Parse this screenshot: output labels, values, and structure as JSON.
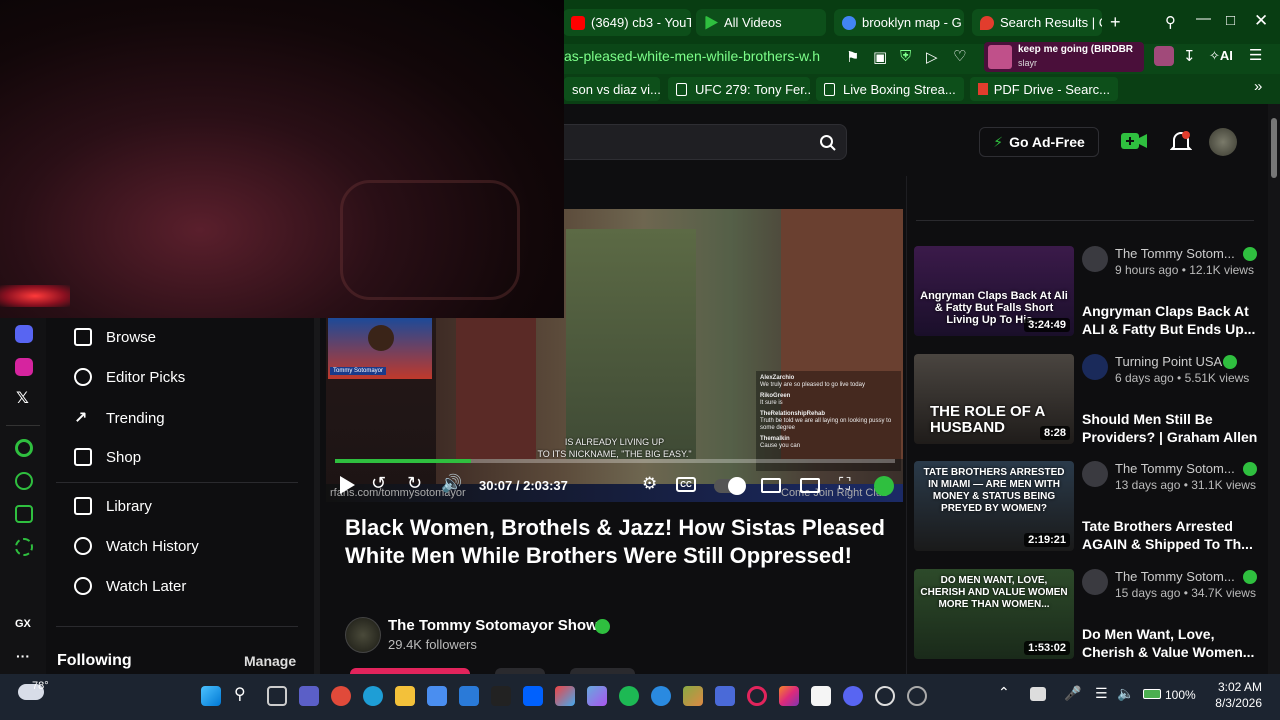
{
  "browser": {
    "tabs": [
      {
        "label": "(3649) cb3 - YouT",
        "icon_color": "#ff0000"
      },
      {
        "label": "All Videos",
        "icon_color": "#2fbf3f"
      },
      {
        "label": "brooklyn map - G",
        "icon_color": "#4285f4"
      },
      {
        "label": "Search Results | C",
        "icon_color": "#e23d2d"
      }
    ],
    "new_tab": "+",
    "url": "as-pleased-white-men-while-brothers-w.h",
    "media_title": "keep me going (BIRDBR",
    "media_artist": "slayr",
    "ai_label": "AI",
    "bookmarks": [
      "son vs diaz vi...",
      "UFC 279: Tony Fer...",
      "Live Boxing Strea...",
      "PDF Drive - Searc..."
    ]
  },
  "header": {
    "go_ad_free": "Go Ad-Free"
  },
  "sidebar": {
    "items": [
      {
        "label": "Browse",
        "icon": "browse-icon"
      },
      {
        "label": "Editor Picks",
        "icon": "award-icon"
      },
      {
        "label": "Trending",
        "icon": "trending-icon"
      },
      {
        "label": "Shop",
        "icon": "shop-icon"
      },
      {
        "label": "Library",
        "icon": "library-icon"
      },
      {
        "label": "Watch History",
        "icon": "history-icon"
      },
      {
        "label": "Watch Later",
        "icon": "clock-icon"
      }
    ],
    "following": "Following",
    "manage": "Manage",
    "rail_gx": "GX"
  },
  "player": {
    "time": "30:07 / 2:03:37",
    "progress": 0.243,
    "pip_name": "Tommy Sotomayor",
    "caption_line1": "IS ALREADY LIVING UP",
    "caption_line2": "TO ITS NICKNAME, \"THE BIG EASY.\"",
    "chat": [
      {
        "user": "AlexZarchio",
        "msg": "We truly are so pleased to go live today"
      },
      {
        "user": "RikoGreen",
        "msg": "It sure is"
      },
      {
        "user": "TheRelationshipRehab",
        "msg": "Truth be told we are all laying on looking pussy to some degree"
      },
      {
        "user": "Themalkin",
        "msg": "Cause you can"
      }
    ],
    "overlay_left": "rfans.com/tommysotomayor",
    "overlay_right": "Come Join Right Club"
  },
  "video": {
    "title": "Black Women, Brothels & Jazz! How Sistas Pleased White Men While Brothers Were Still Oppressed!",
    "channel": "The Tommy Sotomayor Show",
    "followers": "29.4K followers"
  },
  "recommendations": [
    {
      "channel": "The Tommy Sotom...",
      "meta": "9 hours ago • 12.1K views",
      "title": "Angryman Claps Back At ALI & Fatty But Ends Up...",
      "duration": "3:24:49",
      "thumb_text": "Angryman Claps Back At Ali & Fatty But Falls Short Living Up To His...",
      "thumb_color": "#3b1a4a"
    },
    {
      "channel": "Turning Point USA",
      "meta": "6 days ago • 5.51K views",
      "title": "Should Men Still Be Providers? | Graham Allen",
      "duration": "8:28",
      "thumb_text": "THE ROLE OF A HUSBAND",
      "thumb_color": "#4a4540"
    },
    {
      "channel": "The Tommy Sotom...",
      "meta": "13 days ago • 31.1K views",
      "title": "Tate Brothers Arrested AGAIN & Shipped To Th...",
      "duration": "2:19:21",
      "thumb_text": "TATE BROTHERS ARRESTED IN MIAMI — ARE MEN WITH MONEY & STATUS BEING PREYED BY WOMEN?",
      "thumb_color": "#2a3a4a"
    },
    {
      "channel": "The Tommy Sotom...",
      "meta": "15 days ago • 34.7K views",
      "title": "Do Men Want, Love, Cherish & Value Women...",
      "duration": "1:53:02",
      "thumb_text": "DO MEN WANT, LOVE, CHERISH AND VALUE WOMEN MORE THAN WOMEN...",
      "thumb_color": "#2d4a2a"
    }
  ],
  "taskbar": {
    "weather": "78°",
    "battery": "100%",
    "time": "3:02 AM",
    "date": "8/3/2026"
  },
  "colors": {
    "accent": "#2fbf3f",
    "browser_bg": "#083d12",
    "page_bg": "#0e0e10"
  }
}
